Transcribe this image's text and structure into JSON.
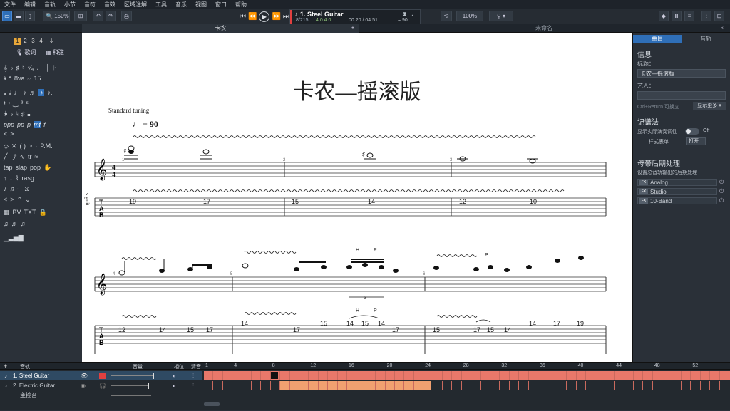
{
  "menu": [
    "文件",
    "编辑",
    "音轨",
    "小节",
    "音符",
    "音效",
    "区域注解",
    "工具",
    "音乐",
    "视图",
    "窗口",
    "帮助"
  ],
  "toolbar": {
    "zoom": "150%",
    "icons": [
      "view-page-icon",
      "view-horizontal-icon",
      "view-vertical-icon",
      "zoom-icon",
      "undo-icon",
      "redo-icon",
      "print-icon"
    ]
  },
  "transport": {
    "track_name": "1. Steel Guitar",
    "bar_position": "8/215",
    "time_signature": "4.0:4.0",
    "time": "00:20 / 04:51",
    "tempo": "♩= 90",
    "volume_label": "100%"
  },
  "tabs": {
    "left": "卡农",
    "right": "未命名"
  },
  "palette": {
    "voices": [
      "1",
      "2",
      "3",
      "4"
    ],
    "lyrics_button": "歌词",
    "chords_button": "和弦"
  },
  "score": {
    "title": "卡农—摇滚版",
    "tuning": "Standard tuning",
    "tempo_mark": "= 90",
    "instrument_abbrev": "s.guit.",
    "system1": {
      "measure_numbers": [
        "1",
        "2",
        "3"
      ],
      "tab_numbers": [
        "19",
        "17",
        "15",
        "14",
        "12",
        "10"
      ]
    },
    "system2": {
      "measure_numbers": [
        "4",
        "5",
        "6"
      ],
      "tab_numbers": [
        "12",
        "14",
        "15",
        "17",
        "14",
        "17",
        "15",
        "14",
        "15",
        "14",
        "17",
        "15",
        "17",
        "15",
        "14",
        "14",
        "17",
        "19"
      ],
      "techniques": [
        "H",
        "P",
        "H",
        "P",
        "P"
      ],
      "tuplet": "3"
    }
  },
  "right_panel": {
    "tab_song": "曲目",
    "tab_track": "音轨",
    "info_heading": "信息",
    "title_label": "标题：",
    "title_value": "卡农—摇滚版",
    "artist_label": "艺人：",
    "artist_value": "",
    "hint": "Ctrl+Return 可换立...",
    "show_more": "显示更多 ▾",
    "notation_heading": "记谱法",
    "show_real_notation": "显示实际演奏调性",
    "toggle_state": "Off",
    "style_label": "样式表单",
    "open_button": "打开...",
    "master_heading": "母带后期处理",
    "master_desc": "设置总音轨输出的后期处理",
    "fx": [
      "Analog",
      "Studio",
      "10-Band"
    ]
  },
  "mixer": {
    "header_tracks": "音轨 ⋮",
    "header_volume": "音量",
    "header_pan": "相位",
    "header_eq": "清音",
    "tracks": [
      "1. Steel Guitar",
      "2. Electric Guitar"
    ],
    "master": "主控台",
    "timeline_numbers": [
      "1",
      "4",
      "8",
      "12",
      "16",
      "20",
      "24",
      "28",
      "32",
      "36",
      "40",
      "44",
      "48",
      "52"
    ]
  },
  "colors": {
    "accent": "#2f6fb8",
    "timeline_fill": "#e8786a",
    "timeline_fill2": "#f0a070",
    "score_bg": "#ffffff"
  }
}
